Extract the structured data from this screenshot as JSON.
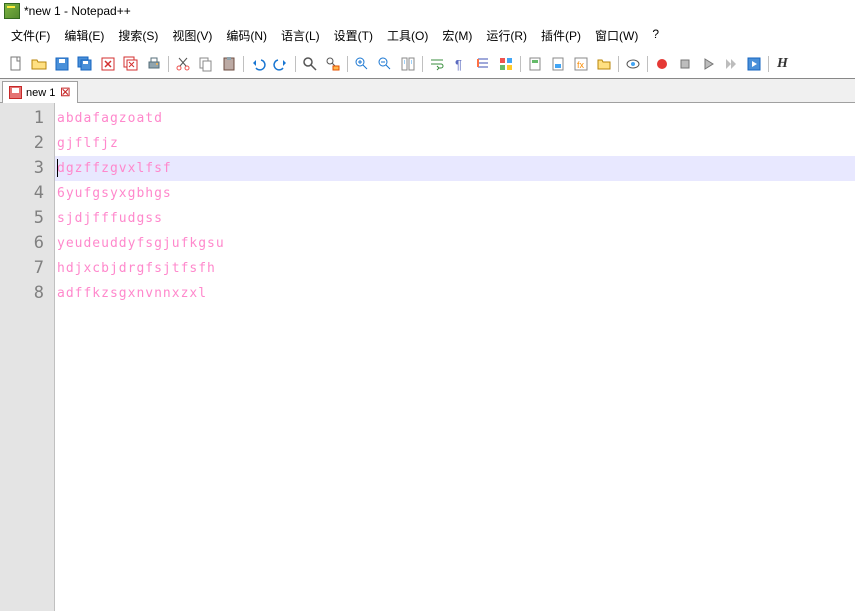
{
  "title": "*new 1 - Notepad++",
  "menus": [
    "文件(F)",
    "编辑(E)",
    "搜索(S)",
    "视图(V)",
    "编码(N)",
    "语言(L)",
    "设置(T)",
    "工具(O)",
    "宏(M)",
    "运行(R)",
    "插件(P)",
    "窗口(W)",
    "?"
  ],
  "tab": {
    "label": "new 1"
  },
  "editor": {
    "lines": [
      "abdafagzoatd",
      "gjflfjz",
      "dgzffzgvxlfsf",
      "6yufgsyxgbhgs",
      "sjdjfffudgss",
      "yeudeuddyfsgjufkgsu",
      "hdjxcbjdrgfsjtfsfh",
      "adffkzsgxnvnnxzxl"
    ],
    "currentLine": 3
  },
  "toolbar_h": "H"
}
